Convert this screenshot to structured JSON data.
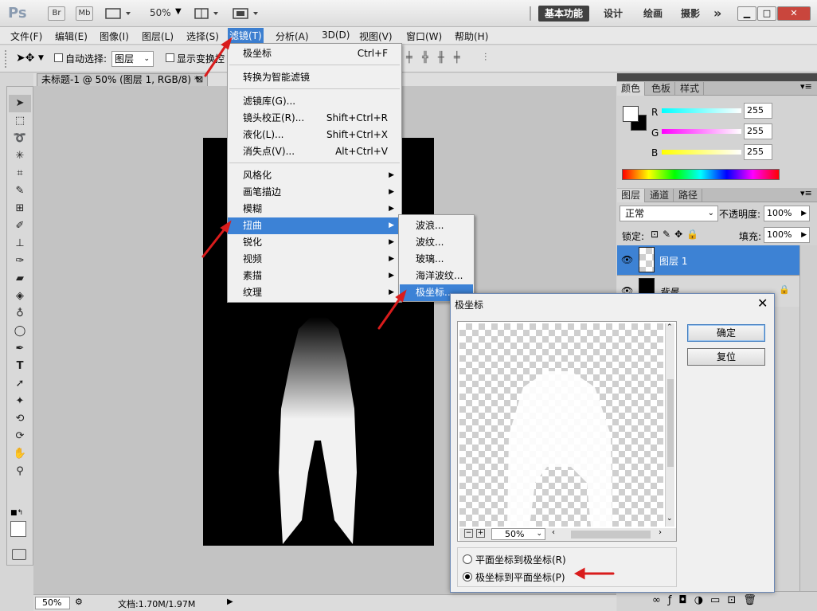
{
  "titlebar": {
    "logo": "Ps",
    "bridge": "Br",
    "minibridge": "Mb",
    "zoom": "50%",
    "workspaces": [
      "基本功能",
      "设计",
      "绘画",
      "摄影"
    ],
    "more": "»",
    "search_placeholder": ""
  },
  "menubar": [
    "文件(F)",
    "编辑(E)",
    "图像(I)",
    "图层(L)",
    "选择(S)",
    "滤镜(T)",
    "分析(A)",
    "3D(D)",
    "视图(V)",
    "窗口(W)",
    "帮助(H)"
  ],
  "optbar": {
    "auto_select_label": "自动选择:",
    "auto_select_value": "图层",
    "show_transform_label": "显示变换控件"
  },
  "doc": {
    "tab_title": "未标题-1 @ 50% (图层 1, RGB/8) *",
    "zoom": "50%",
    "status": "文档:1.70M/1.97M"
  },
  "filter_menu": {
    "items": [
      {
        "label": "极坐标",
        "shortcut": "Ctrl+F"
      },
      {
        "label": "转换为智能滤镜",
        "shortcut": ""
      },
      {
        "label": "滤镜库(G)...",
        "shortcut": ""
      },
      {
        "label": "镜头校正(R)...",
        "shortcut": "Shift+Ctrl+R"
      },
      {
        "label": "液化(L)...",
        "shortcut": "Shift+Ctrl+X"
      },
      {
        "label": "消失点(V)...",
        "shortcut": "Alt+Ctrl+V"
      },
      {
        "label": "风格化",
        "shortcut": ""
      },
      {
        "label": "画笔描边",
        "shortcut": ""
      },
      {
        "label": "模糊",
        "shortcut": ""
      },
      {
        "label": "扭曲",
        "shortcut": ""
      },
      {
        "label": "锐化",
        "shortcut": ""
      },
      {
        "label": "视频",
        "shortcut": ""
      },
      {
        "label": "素描",
        "shortcut": ""
      },
      {
        "label": "纹理",
        "shortcut": ""
      }
    ]
  },
  "distort_submenu": [
    "波浪...",
    "波纹...",
    "玻璃...",
    "海洋波纹...",
    "极坐标..."
  ],
  "dialog": {
    "title": "极坐标",
    "ok": "确定",
    "reset": "复位",
    "zoom": "50%",
    "option1": "平面坐标到极坐标(R)",
    "option2": "极坐标到平面坐标(P)",
    "selected": "option2"
  },
  "color_panel": {
    "tabs": [
      "颜色",
      "色板",
      "样式"
    ],
    "r_label": "R",
    "g_label": "G",
    "b_label": "B",
    "r": "255",
    "g": "255",
    "b": "255"
  },
  "layers_panel": {
    "tabs": [
      "图层",
      "通道",
      "路径"
    ],
    "blend_mode": "正常",
    "opacity_label": "不透明度:",
    "opacity": "100%",
    "lock_label": "锁定:",
    "fill_label": "填充:",
    "fill": "100%",
    "layers": [
      "图层 1",
      "背景"
    ]
  }
}
